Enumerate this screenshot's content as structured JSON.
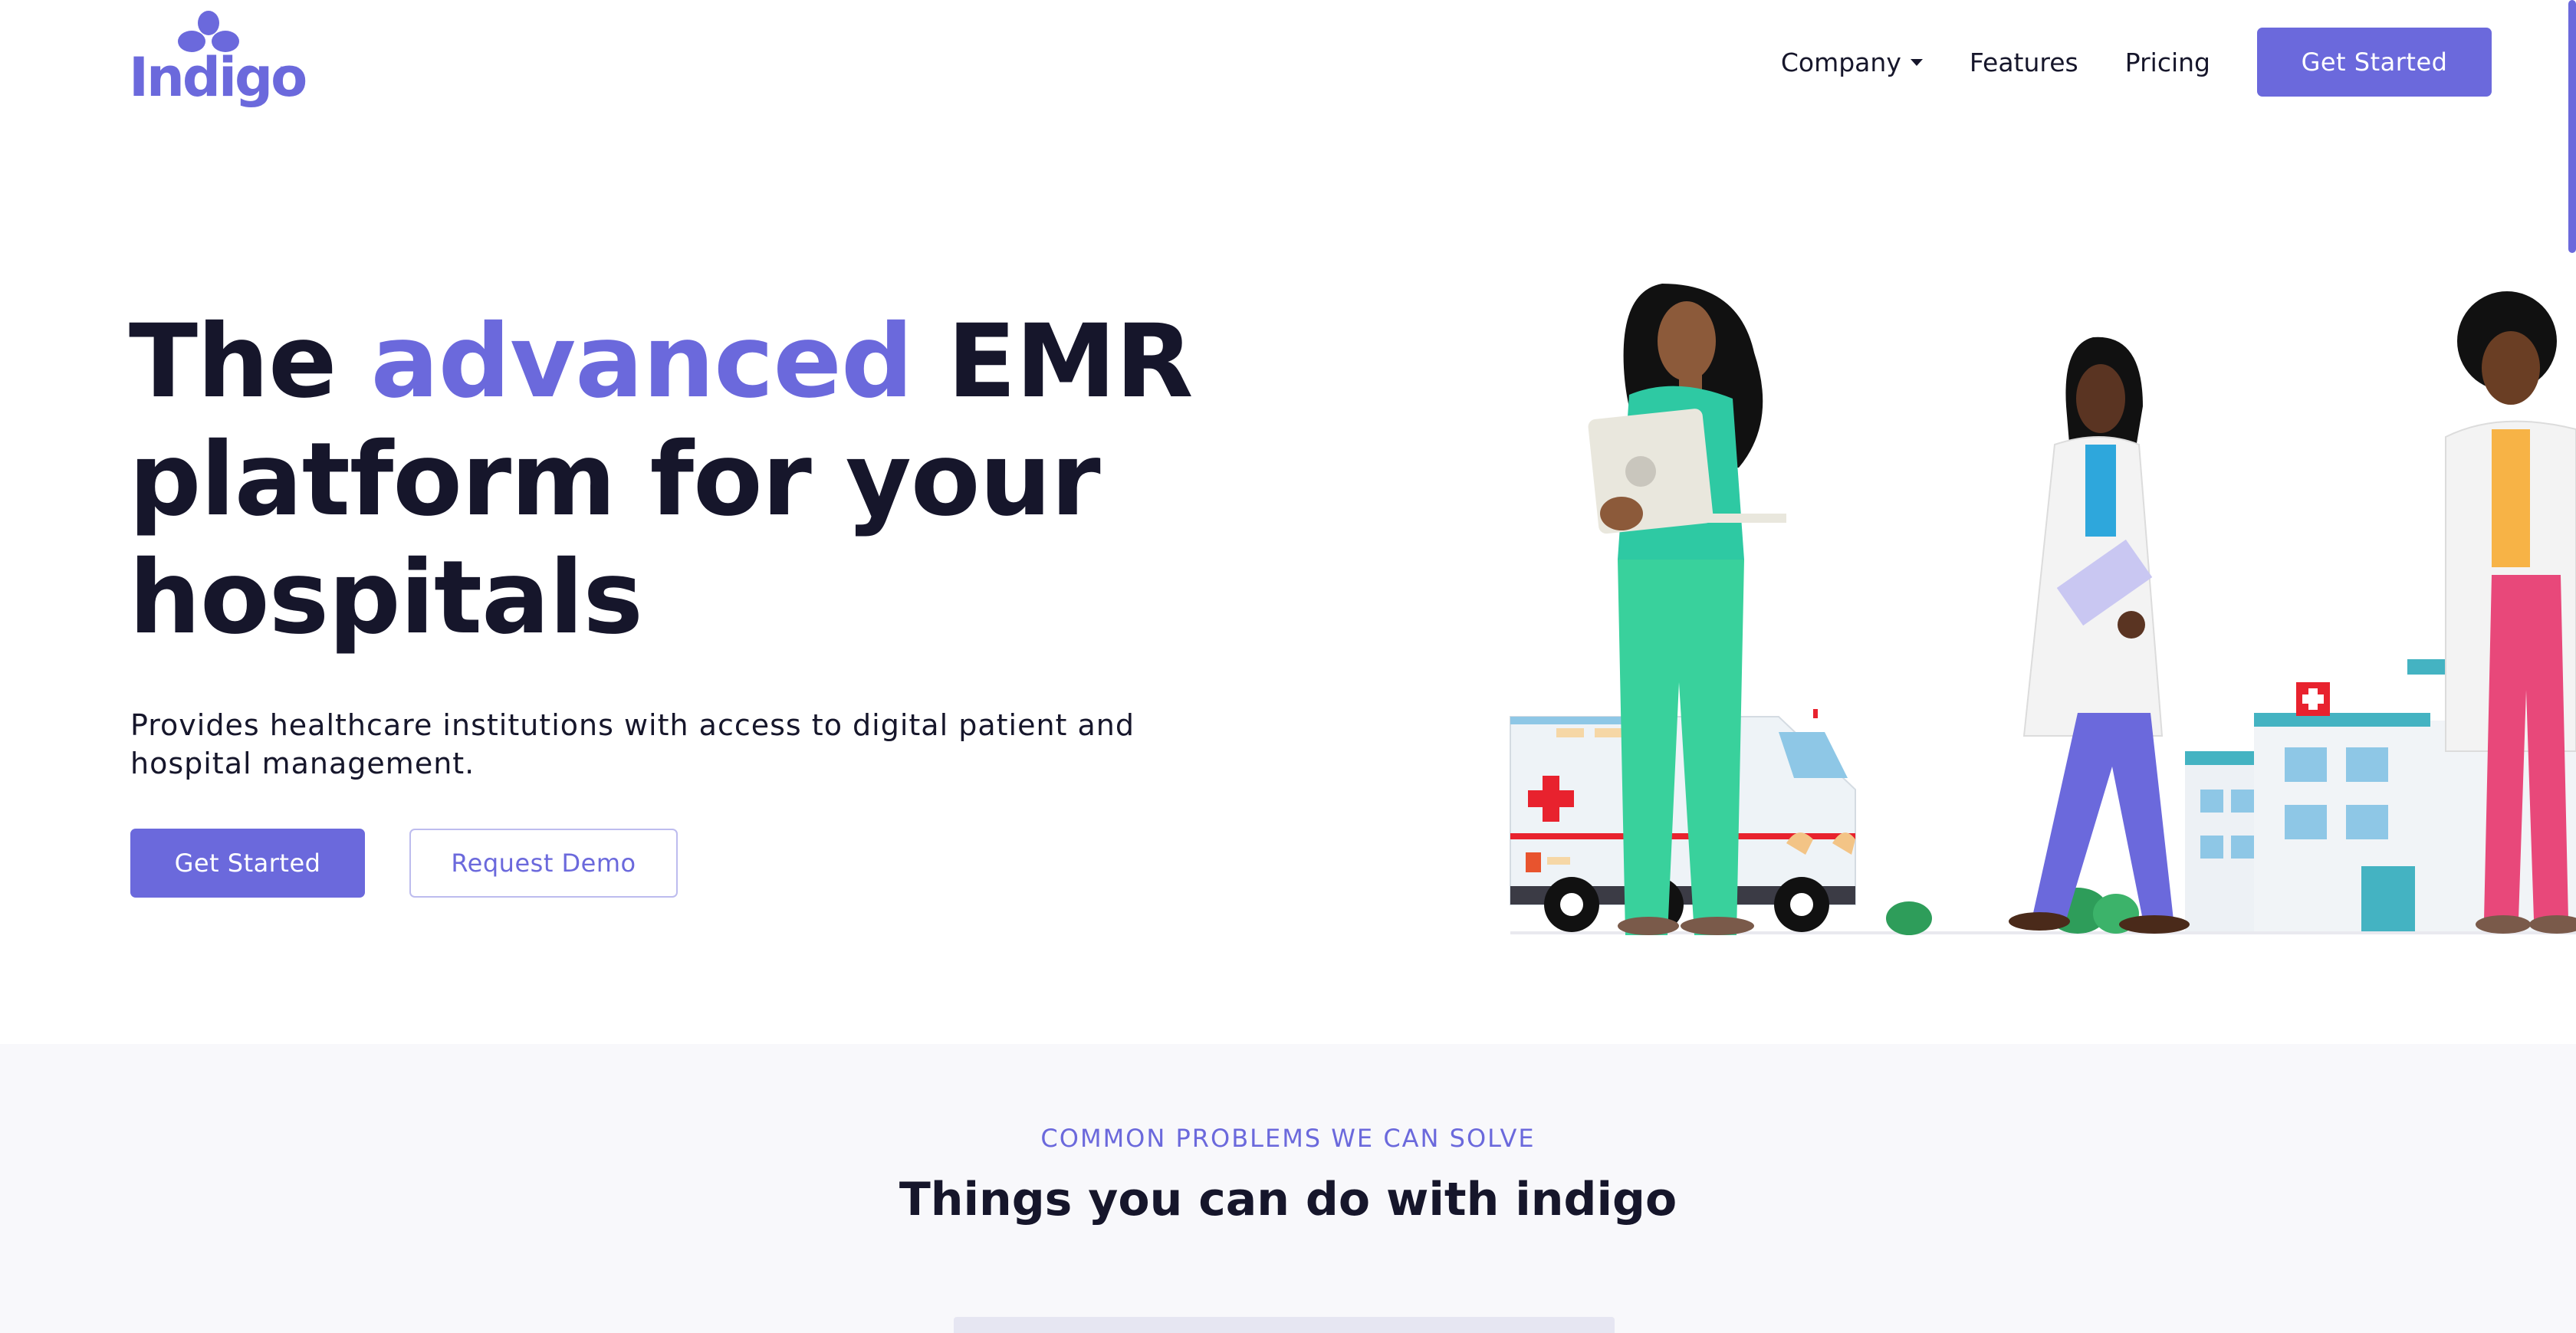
{
  "brand": {
    "name": "Indigo",
    "tm": "™"
  },
  "nav": {
    "items": [
      {
        "label": "Company",
        "has_dropdown": true
      },
      {
        "label": "Features"
      },
      {
        "label": "Pricing"
      }
    ],
    "cta": "Get Started"
  },
  "hero": {
    "title_pre": "The ",
    "title_accent": "advanced",
    "title_post": " EMR platform for your hospitals",
    "subtitle": "Provides healthcare institutions with access to digital patient and hospital management.",
    "primary_button": "Get Started",
    "secondary_button": "Request Demo"
  },
  "section": {
    "eyebrow": "COMMON PROBLEMS WE CAN SOLVE",
    "title": "Things you can do with indigo"
  },
  "colors": {
    "accent": "#6b69dc",
    "text": "#16162b",
    "section_bg": "#f8f8fb"
  }
}
